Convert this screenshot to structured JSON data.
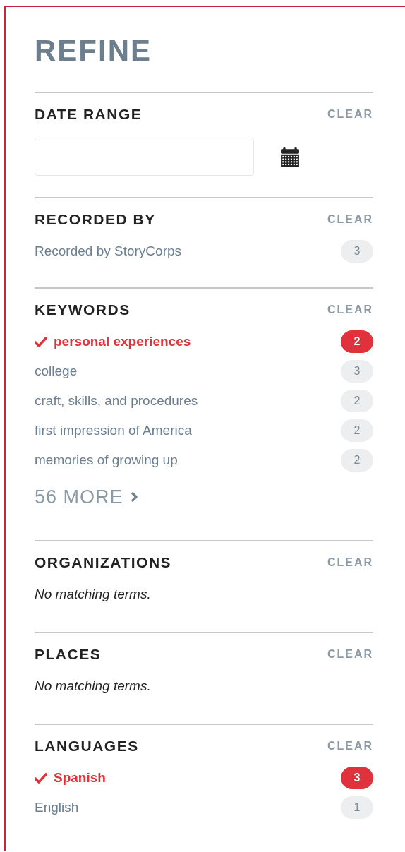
{
  "title": "REFINE",
  "sections": [
    {
      "kind": "date",
      "heading": "DATE RANGE",
      "clear": "CLEAR"
    },
    {
      "kind": "list",
      "heading": "RECORDED BY",
      "clear": "CLEAR",
      "items": [
        {
          "label": "Recorded by StoryCorps",
          "count": "3",
          "selected": false
        }
      ]
    },
    {
      "kind": "list",
      "heading": "KEYWORDS",
      "clear": "CLEAR",
      "items": [
        {
          "label": "personal experiences",
          "count": "2",
          "selected": true
        },
        {
          "label": "college",
          "count": "3",
          "selected": false
        },
        {
          "label": "craft, skills, and procedures",
          "count": "2",
          "selected": false
        },
        {
          "label": "first impression of America",
          "count": "2",
          "selected": false
        },
        {
          "label": "memories of growing up",
          "count": "2",
          "selected": false
        }
      ],
      "more": "56 MORE"
    },
    {
      "kind": "empty",
      "heading": "ORGANIZATIONS",
      "clear": "CLEAR",
      "note": "No matching terms."
    },
    {
      "kind": "empty",
      "heading": "PLACES",
      "clear": "CLEAR",
      "note": "No matching terms."
    },
    {
      "kind": "list",
      "heading": "LANGUAGES",
      "clear": "CLEAR",
      "items": [
        {
          "label": "Spanish",
          "count": "3",
          "selected": true
        },
        {
          "label": "English",
          "count": "1",
          "selected": false
        }
      ]
    }
  ]
}
